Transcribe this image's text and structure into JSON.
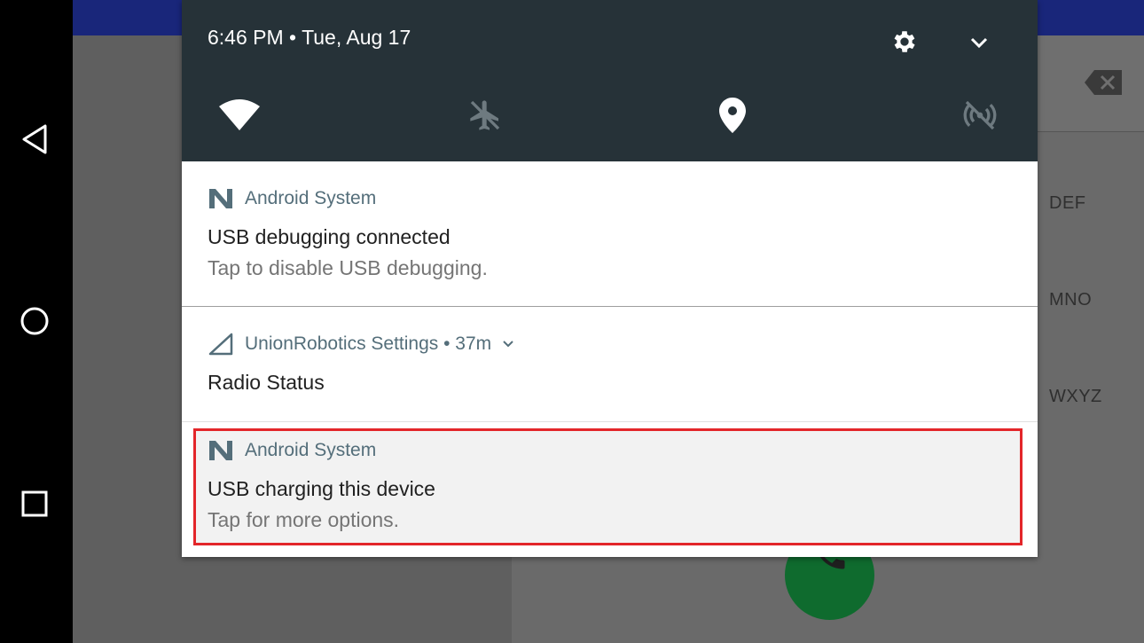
{
  "status_bar": {
    "time_date": "6:46 PM • Tue, Aug 17"
  },
  "quick_settings": {
    "tiles": [
      {
        "name": "wifi",
        "icon": "wifi-icon",
        "state": "on"
      },
      {
        "name": "airplane-mode",
        "icon": "airplane-off-icon",
        "state": "off"
      },
      {
        "name": "location",
        "icon": "location-pin-icon",
        "state": "on"
      },
      {
        "name": "hotspot",
        "icon": "hotspot-off-icon",
        "state": "off"
      }
    ],
    "settings_icon": "gear-icon",
    "expand_icon": "chevron-down-icon"
  },
  "notifications": [
    {
      "app": "Android System",
      "title": "USB debugging connected",
      "text": "Tap to disable USB debugging."
    },
    {
      "app": "UnionRobotics Settings • 37m",
      "title": "Radio Status"
    },
    {
      "app": "Android System",
      "title": "USB charging this device",
      "text": "Tap for more options.",
      "highlighted": true
    }
  ],
  "background_app": {
    "keypad_letters": [
      "DEF",
      "MNO",
      "WXYZ"
    ],
    "call_icon": "phone-icon",
    "backspace_icon": "backspace-icon"
  },
  "nav_bar": {
    "buttons": [
      "back-icon",
      "home-icon",
      "recents-icon"
    ]
  },
  "colors": {
    "quick_settings_bg": "#263238",
    "highlight_border": "#e3262a",
    "app_icon_tint": "#546e7a",
    "call_button": "#0f6b2e"
  }
}
